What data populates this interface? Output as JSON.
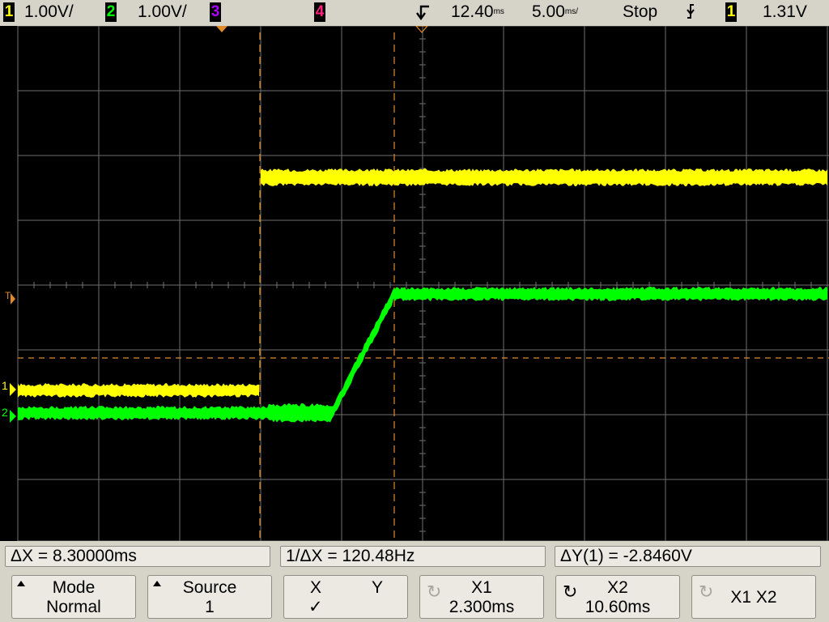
{
  "top_bar": {
    "ch1": {
      "num": "1",
      "scale": "1.00V/",
      "color": "#ffff00"
    },
    "ch2": {
      "num": "2",
      "scale": "1.00V/",
      "color": "#00ff00"
    },
    "ch3": {
      "num": "3",
      "color": "#b000ff"
    },
    "ch4": {
      "num": "4",
      "color": "#ff2080"
    },
    "delay": "12.40",
    "delay_unit": "ms",
    "timebase": "5.00",
    "timebase_unit": "ms/",
    "run_state": "Stop",
    "trigger_slope_icon": "falling-edge-icon",
    "trigger_source": "1",
    "trigger_level": "1.31V"
  },
  "screen": {
    "trigger_marker": "T",
    "ch1_marker": "1",
    "ch2_marker": "2",
    "colors": {
      "grid": "#707070",
      "cursor": "#e08a2a",
      "ch1": "#ffff00",
      "ch2": "#00ff00"
    }
  },
  "measurements": {
    "delta_x": "ΔX = 8.30000ms",
    "inv_delta_x": "1/ΔX = 120.48Hz",
    "delta_y": "ΔY(1) = -2.8460V"
  },
  "softkeys": {
    "mode": {
      "title": "Mode",
      "value": "Normal"
    },
    "source": {
      "title": "Source",
      "value": "1"
    },
    "xy": {
      "x_label": "X",
      "y_label": "Y",
      "check": "✓"
    },
    "x1": {
      "title": "X1",
      "value": "2.300ms"
    },
    "x2": {
      "title": "X2",
      "value": "10.60ms"
    },
    "x1x2": {
      "title": "X1 X2"
    }
  }
}
